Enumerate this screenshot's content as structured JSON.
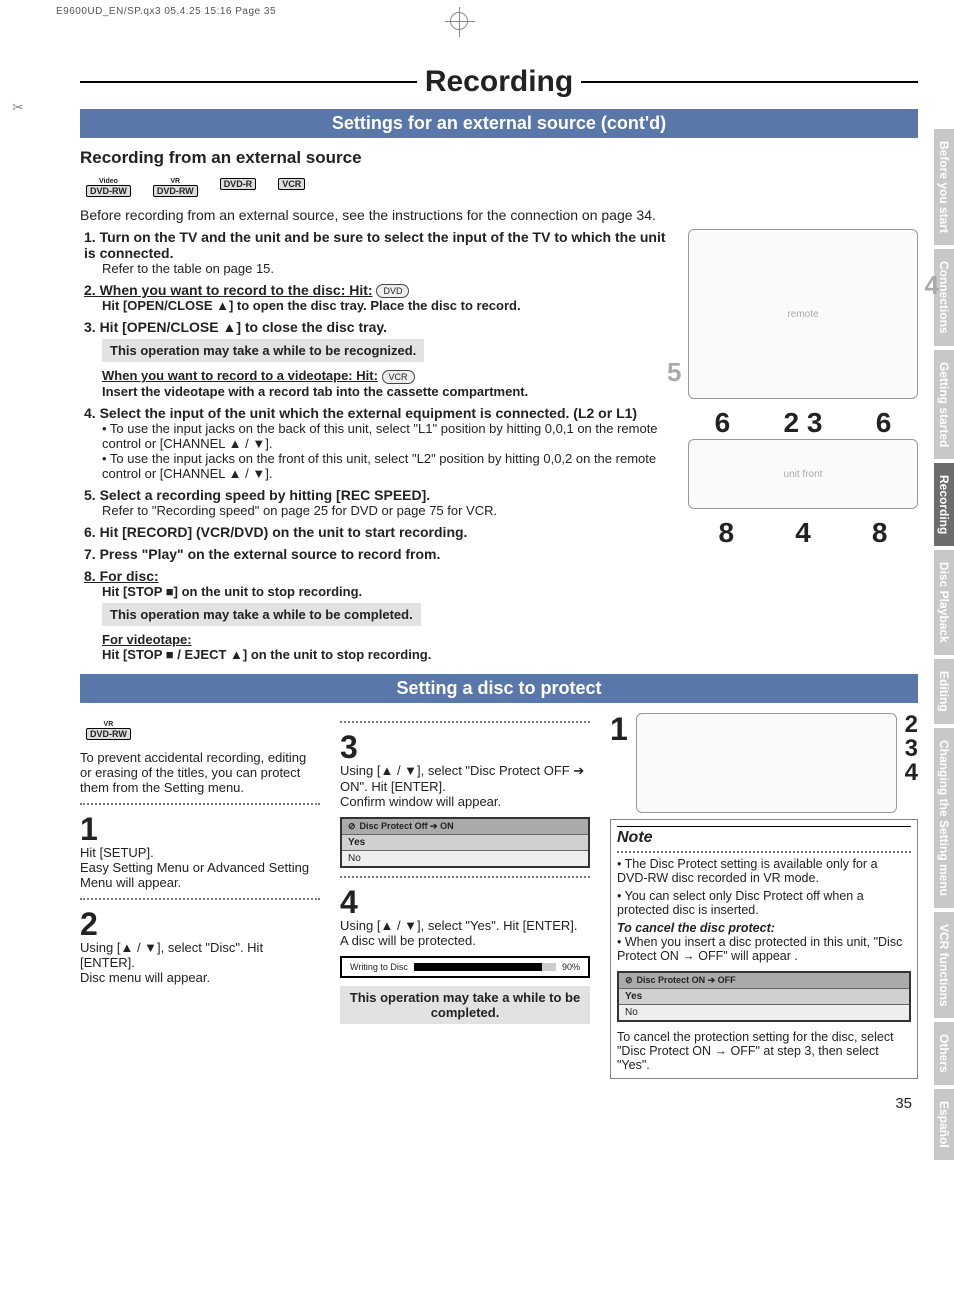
{
  "meta": {
    "header": "E9600UD_EN/SP.qx3   05.4.25 15:16   Page 35",
    "page_number": "35"
  },
  "titles": {
    "main": "Recording",
    "sub1": "Settings for an external source (cont'd)",
    "sec1": "Recording from an external source",
    "sub2": "Setting a disc to protect"
  },
  "badges": {
    "b1_top": "Video",
    "b1": "DVD-RW",
    "b2_top": "VR",
    "b2": "DVD-RW",
    "b3": "DVD-R",
    "b4": "VCR"
  },
  "s1": {
    "intro": "Before recording from an external source, see the instructions for the connection on page 34.",
    "step1a": "1. Turn on the TV and the unit and be sure to select the input of the TV to which the unit is connected.",
    "step1b": "Refer to the table on page 15.",
    "step2a": "2.  When you want to record to the disc:  Hit:",
    "step2b": "Hit [OPEN/CLOSE ▲] to open the disc tray. Place the disc to record.",
    "step3": "3. Hit [OPEN/CLOSE ▲] to close the disc tray.",
    "note1": "This operation may take a while to be recognized.",
    "step3b": "When you want to record to a videotape:  Hit:",
    "step3c": "Insert the videotape with a record tab into the cassette compartment.",
    "step4a": "4. Select the input of the unit which the external equipment is connected. (L2 or L1)",
    "step4b": "• To use the input jacks on the back of this unit, select \"L1\" position by hitting 0,0,1 on the remote control or [CHANNEL ▲ / ▼].",
    "step4c": "• To use the input jacks on the front of this unit, select \"L2\" position by hitting 0,0,2 on the remote control or [CHANNEL ▲ / ▼].",
    "step5a": "5. Select a recording speed by hitting [REC SPEED].",
    "step5b": "Refer to \"Recording speed\" on page 25 for DVD or page 75 for VCR.",
    "step6": "6. Hit [RECORD] (VCR/DVD) on the unit to start recording.",
    "step7": "7. Press \"Play\" on the external source to record from.",
    "step8a": "8.  For disc:",
    "step8b": "Hit [STOP ■] on the unit to stop recording.",
    "note2": "This operation may take a while to be completed.",
    "step8c": "For videotape:",
    "step8d": "Hit [STOP ■ / EJECT ▲] on the unit to stop recording."
  },
  "diag": {
    "label4": "4",
    "label5": "5",
    "unit_nums_top": [
      "6",
      "2 3",
      "6"
    ],
    "unit_nums_bot": [
      "8",
      "4",
      "8"
    ]
  },
  "s2": {
    "intro": "To prevent accidental recording, editing or erasing of the titles, you can protect them from the Setting menu.",
    "st1_t": "Hit [SETUP].",
    "st1_b": "Easy Setting Menu or Advanced Setting Menu will appear.",
    "st2_t": "Using [▲ / ▼], select \"Disc\". Hit [ENTER].",
    "st2_b": "Disc menu will appear.",
    "st3_t": "Using [▲ / ▼], select \"Disc Protect OFF ➔ ON\". Hit [ENTER].",
    "st3_b": "Confirm window will appear.",
    "menu1_title": "Disc Protect Off ➔ ON",
    "menu_yes": "Yes",
    "menu_no": "No",
    "st4_t": "Using [▲ / ▼], select \"Yes\". Hit [ENTER].",
    "st4_b": "A disc will be protected.",
    "progress_label": "Writing to Disc",
    "progress_pct": "90%",
    "note3": "This operation may take a while to be completed.",
    "note_title": "Note",
    "note_li1": "• The Disc Protect setting is available only for a DVD-RW disc recorded in VR mode.",
    "note_li2": "• You can select only Disc Protect off when a protected disc is inserted.",
    "note_cancel_t": "To cancel the disc protect:",
    "note_li3": "• When you insert a disc protected in this unit, \"Disc Protect ON → OFF\" will appear .",
    "menu2_title": "Disc Protect ON ➔ OFF",
    "note_li4": "To cancel the protection setting for the disc, select \"Disc Protect ON → OFF\" at step 3, then select \"Yes\".",
    "small_nums": [
      "1",
      "2",
      "3",
      "4"
    ]
  },
  "tabs": [
    "Before you start",
    "Connections",
    "Getting started",
    "Recording",
    "Disc Playback",
    "Editing",
    "Changing the Setting menu",
    "VCR functions",
    "Others",
    "Español"
  ],
  "active_tab": "Recording"
}
